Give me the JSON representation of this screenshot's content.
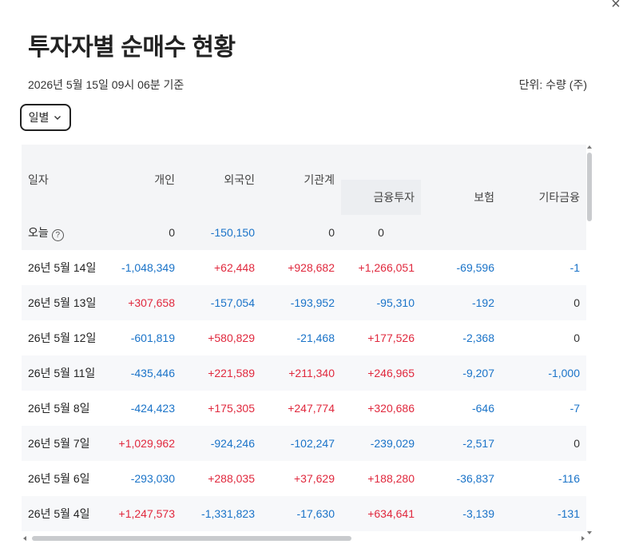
{
  "header": {
    "title": "투자자별 순매수 현황",
    "timestamp": "2026년 5월 15일 09시 06분 기준",
    "unit": "단위: 수량 (주)",
    "close_symbol": "×"
  },
  "filter": {
    "period_label": "일별"
  },
  "table": {
    "columns": {
      "date": "일자",
      "individual": "개인",
      "foreign": "외국인",
      "institution_total": "기관계",
      "financial_investment": "금융투자",
      "insurance": "보험",
      "other_financial": "기타금융"
    },
    "today": {
      "label": "오늘",
      "info_symbol": "?",
      "individual": "0",
      "foreign": "-150,150",
      "institution_total": "0",
      "financial_investment": "0"
    },
    "rows": [
      {
        "date": "26년 5월 14일",
        "individual": "-1,048,349",
        "foreign": "+62,448",
        "institution_total": "+928,682",
        "financial_investment": "+1,266,051",
        "insurance": "-69,596",
        "other_financial": "-1"
      },
      {
        "date": "26년 5월 13일",
        "individual": "+307,658",
        "foreign": "-157,054",
        "institution_total": "-193,952",
        "financial_investment": "-95,310",
        "insurance": "-192",
        "other_financial": "0"
      },
      {
        "date": "26년 5월 12일",
        "individual": "-601,819",
        "foreign": "+580,829",
        "institution_total": "-21,468",
        "financial_investment": "+177,526",
        "insurance": "-2,368",
        "other_financial": "0"
      },
      {
        "date": "26년 5월 11일",
        "individual": "-435,446",
        "foreign": "+221,589",
        "institution_total": "+211,340",
        "financial_investment": "+246,965",
        "insurance": "-9,207",
        "other_financial": "-1,000"
      },
      {
        "date": "26년 5월 8일",
        "individual": "-424,423",
        "foreign": "+175,305",
        "institution_total": "+247,774",
        "financial_investment": "+320,686",
        "insurance": "-646",
        "other_financial": "-7"
      },
      {
        "date": "26년 5월 7일",
        "individual": "+1,029,962",
        "foreign": "-924,246",
        "institution_total": "-102,247",
        "financial_investment": "-239,029",
        "insurance": "-2,517",
        "other_financial": "0"
      },
      {
        "date": "26년 5월 6일",
        "individual": "-293,030",
        "foreign": "+288,035",
        "institution_total": "+37,629",
        "financial_investment": "+188,280",
        "insurance": "-36,837",
        "other_financial": "-116"
      },
      {
        "date": "26년 5월 4일",
        "individual": "+1,247,573",
        "foreign": "-1,331,823",
        "institution_total": "-17,630",
        "financial_investment": "+634,641",
        "insurance": "-3,139",
        "other_financial": "-131"
      }
    ]
  },
  "colors": {
    "positive": "#e0283d",
    "negative": "#1a73c8",
    "header_bg": "#f4f5f7"
  }
}
